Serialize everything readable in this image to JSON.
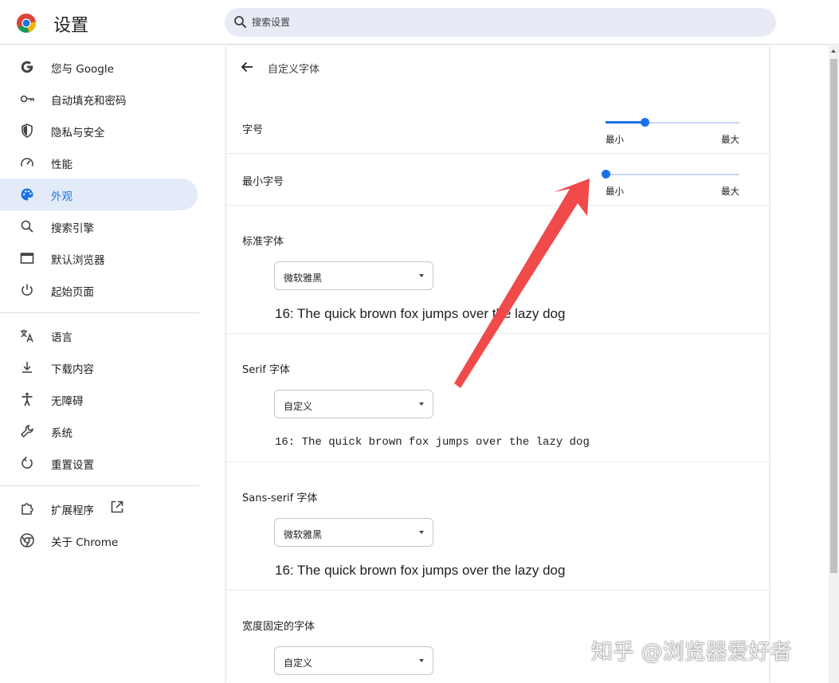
{
  "app": {
    "title": "设置"
  },
  "search": {
    "placeholder": "搜索设置"
  },
  "sidebar": {
    "items": [
      {
        "label": "您与 Google",
        "icon": "google-g-icon"
      },
      {
        "label": "自动填充和密码",
        "icon": "key-icon"
      },
      {
        "label": "隐私与安全",
        "icon": "shield-icon"
      },
      {
        "label": "性能",
        "icon": "speedometer-icon"
      },
      {
        "label": "外观",
        "icon": "palette-icon",
        "active": true
      },
      {
        "label": "搜索引擎",
        "icon": "search-icon"
      },
      {
        "label": "默认浏览器",
        "icon": "browser-window-icon"
      },
      {
        "label": "起始页面",
        "icon": "power-icon"
      },
      {
        "label": "语言",
        "icon": "translate-icon"
      },
      {
        "label": "下载内容",
        "icon": "download-icon"
      },
      {
        "label": "无障碍",
        "icon": "accessibility-icon"
      },
      {
        "label": "系统",
        "icon": "wrench-icon"
      },
      {
        "label": "重置设置",
        "icon": "reset-icon"
      },
      {
        "label": "扩展程序",
        "icon": "puzzle-icon"
      },
      {
        "label": "关于 Chrome",
        "icon": "chrome-icon"
      }
    ]
  },
  "page": {
    "subtitle": "自定义字体",
    "font_size": {
      "label": "字号",
      "min_label": "最小",
      "max_label": "最大",
      "value_fraction": 0.29
    },
    "min_font_size": {
      "label": "最小字号",
      "min_label": "最小",
      "max_label": "最大",
      "value_fraction": 0.0
    },
    "standard_font": {
      "label": "标准字体",
      "selected": "微软雅黑",
      "sample": "16: The quick brown fox jumps over the lazy dog"
    },
    "serif_font": {
      "label": "Serif 字体",
      "selected": "自定义",
      "sample": "16: The quick brown fox jumps over the lazy dog"
    },
    "sans_serif_font": {
      "label": "Sans-serif 字体",
      "selected": "微软雅黑",
      "sample": "16: The quick brown fox jumps over the lazy dog"
    },
    "fixed_width_font": {
      "label": "宽度固定的字体",
      "selected": "自定义"
    }
  },
  "watermark": "知乎 @浏览器爱好者",
  "colors": {
    "accent": "#1a73e8",
    "active_nav_bg": "#e3eaf8",
    "annotation_arrow": "#f04a4a"
  }
}
